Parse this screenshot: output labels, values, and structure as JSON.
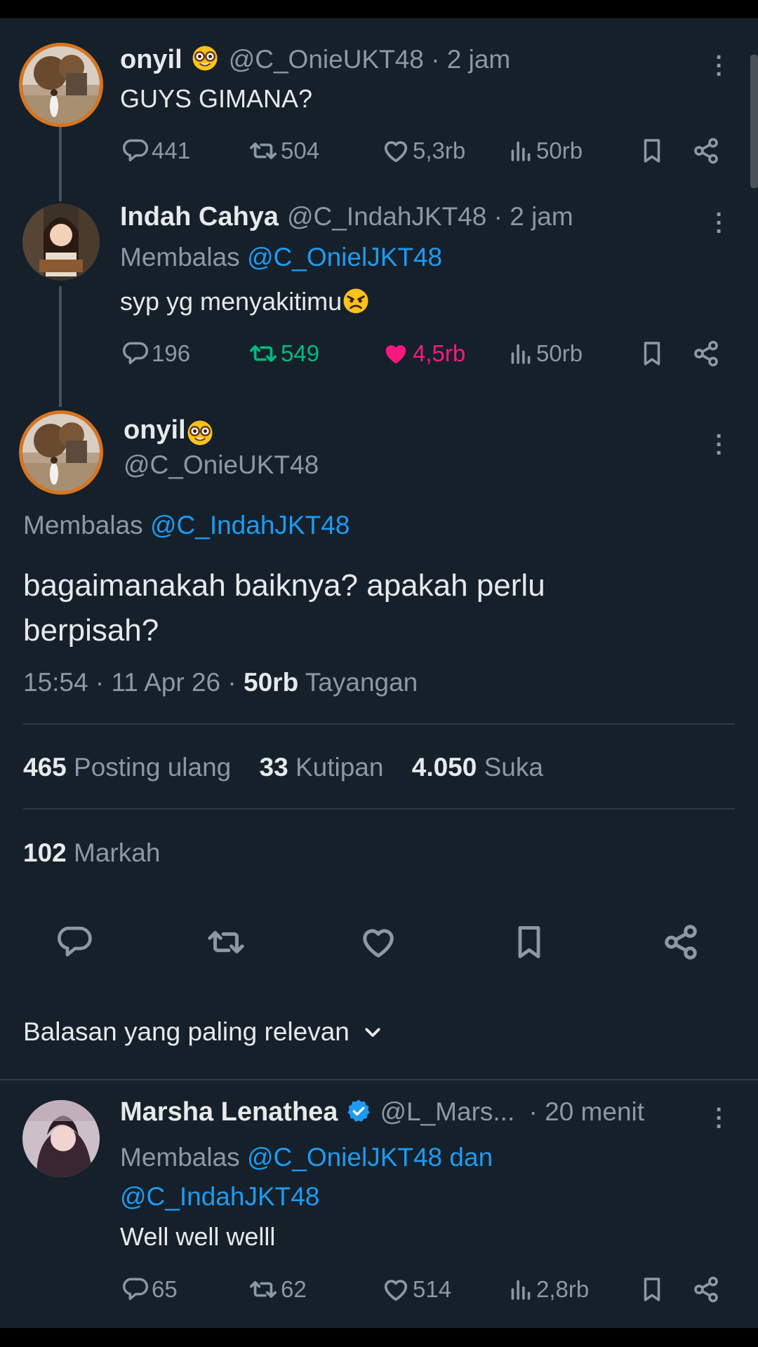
{
  "tweet1": {
    "name": "onyil",
    "handle": "@C_OnieUKT48",
    "time": "· 2 jam",
    "text": "GUYS GIMANA?",
    "stats": {
      "replies": "441",
      "reposts": "504",
      "likes": "5,3rb",
      "views": "50rb"
    },
    "avatar_icon": "landscape-avatar"
  },
  "tweet2": {
    "name": "Indah Cahya",
    "handle": "@C_IndahJKT48",
    "time": "· 2 jam",
    "reply_prefix": "Membalas",
    "reply_to": "@C_OnielJKT48",
    "text": "syp yg menyakitimu",
    "stats": {
      "replies": "196",
      "reposts": "549",
      "likes": "4,5rb",
      "views": "50rb"
    },
    "avatar_icon": "illustrated-girl-avatar"
  },
  "main": {
    "name": "onyil",
    "handle": "@C_OnieUKT48",
    "reply_prefix": "Membalas",
    "reply_to": "@C_IndahJKT48",
    "text_line1": "bagaimanakah baiknya? apakah perlu",
    "text_line2": "berpisah?",
    "time": "15:54 · 11 Apr 26 · ",
    "views_count": "50rb",
    "views_label": " Tayangan",
    "reposts_count": "465",
    "reposts_label": "Posting ulang",
    "quotes_count": "33",
    "quotes_label": "Kutipan",
    "likes_count": "4.050",
    "likes_label": "Suka",
    "bookmarks_count": "102",
    "bookmarks_label": "Markah"
  },
  "sort": {
    "label": "Balasan yang paling relevan"
  },
  "reply": {
    "name": "Marsha Lenathea",
    "handle": "@L_Mars...",
    "time": "· 20 menit",
    "reply_prefix": "Membalas",
    "reply_to_1": "@C_OnielJKT48 dan",
    "reply_to_2": "@C_IndahJKT48",
    "text": "Well well welll",
    "stats": {
      "replies": "65",
      "reposts": "62",
      "likes": "514",
      "views": "2,8rb"
    },
    "verified": true
  },
  "colors": {
    "background": "#15202b",
    "accent": "#1d9bf0",
    "repost_active": "#00ba7c",
    "like_active": "#f91880",
    "muted": "#8b98a5"
  }
}
